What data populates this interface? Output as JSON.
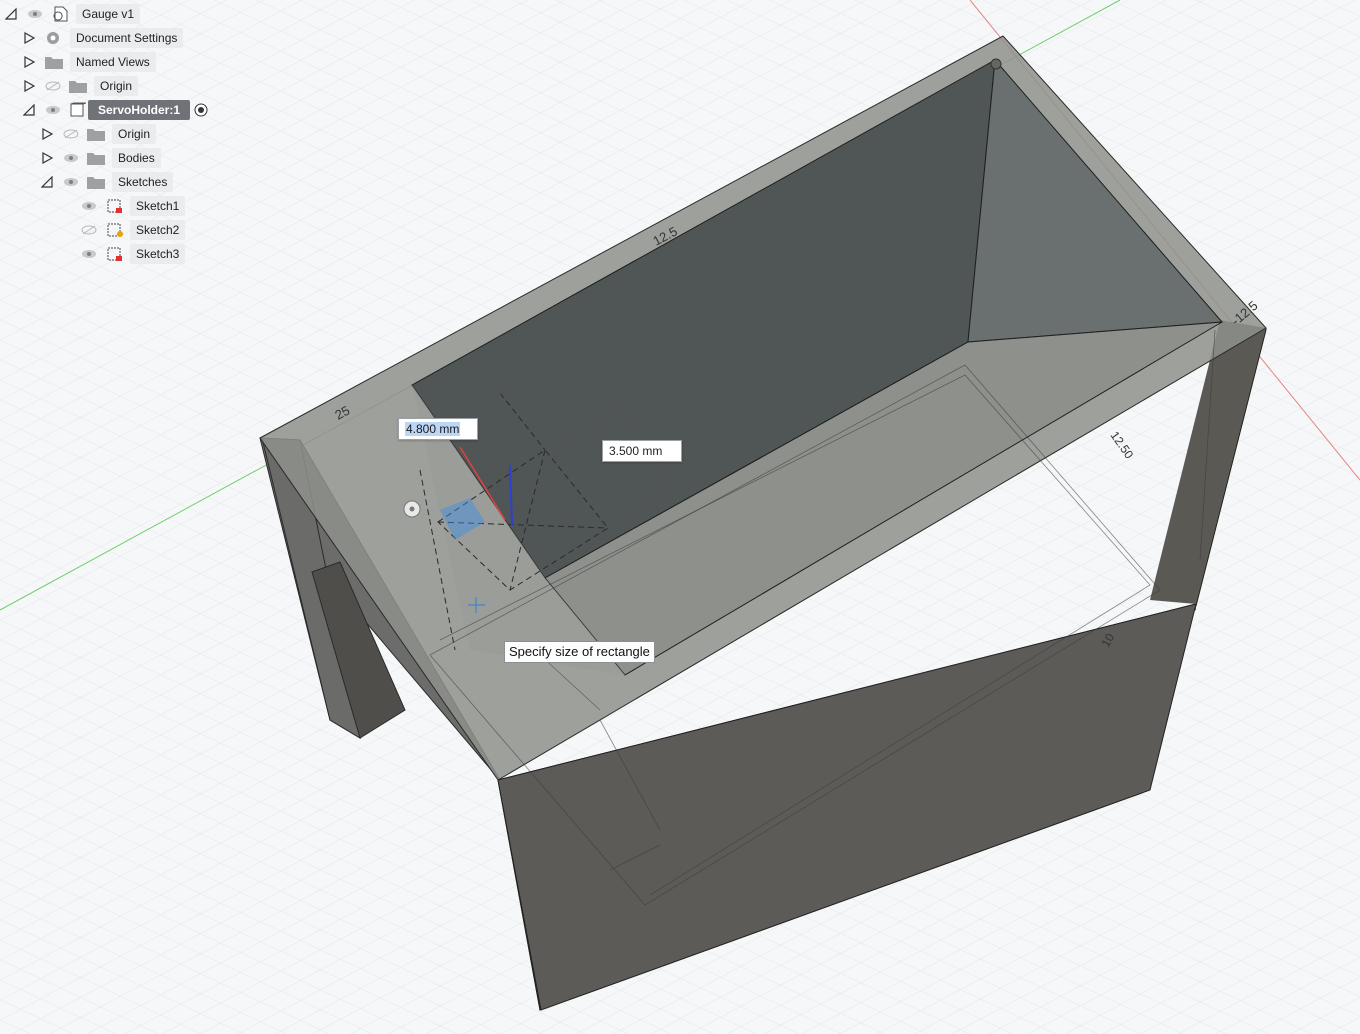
{
  "browser": {
    "root": {
      "label": "Gauge v1",
      "icon": "document-icon"
    },
    "items": [
      {
        "label": "Document Settings",
        "icon": "gear-icon"
      },
      {
        "label": "Named Views",
        "icon": "folder-icon"
      },
      {
        "label": "Origin",
        "icon": "folder-icon",
        "visibility": "hidden"
      },
      {
        "label": "ServoHolder:1",
        "icon": "component-icon",
        "active": true
      },
      {
        "label": "Origin",
        "icon": "folder-icon",
        "visibility": "hidden"
      },
      {
        "label": "Bodies",
        "icon": "folder-icon"
      },
      {
        "label": "Sketches",
        "icon": "folder-icon"
      },
      {
        "label": "Sketch1",
        "icon": "sketch-icon"
      },
      {
        "label": "Sketch2",
        "icon": "sketch-icon",
        "visibility": "hidden"
      },
      {
        "label": "Sketch3",
        "icon": "sketch-icon"
      }
    ]
  },
  "canvas": {
    "dims": {
      "width_input": "4.800 mm",
      "height_input": "3.500 mm"
    },
    "model_labels": {
      "top_edge": "12.5",
      "left_edge": "25",
      "right_edge": "-12.5",
      "side_dim": "12.50",
      "small": "10"
    },
    "tooltip": "Specify size of rectangle"
  },
  "colors": {
    "background": "#f6f7f8",
    "grid": "#dfe3e7",
    "x_axis": "#e36b6b",
    "y_axis": "#5fc25f",
    "body_dark": "#5a5c5c",
    "body_face": "#8d8f8c",
    "selection": "#3a8ee6"
  }
}
